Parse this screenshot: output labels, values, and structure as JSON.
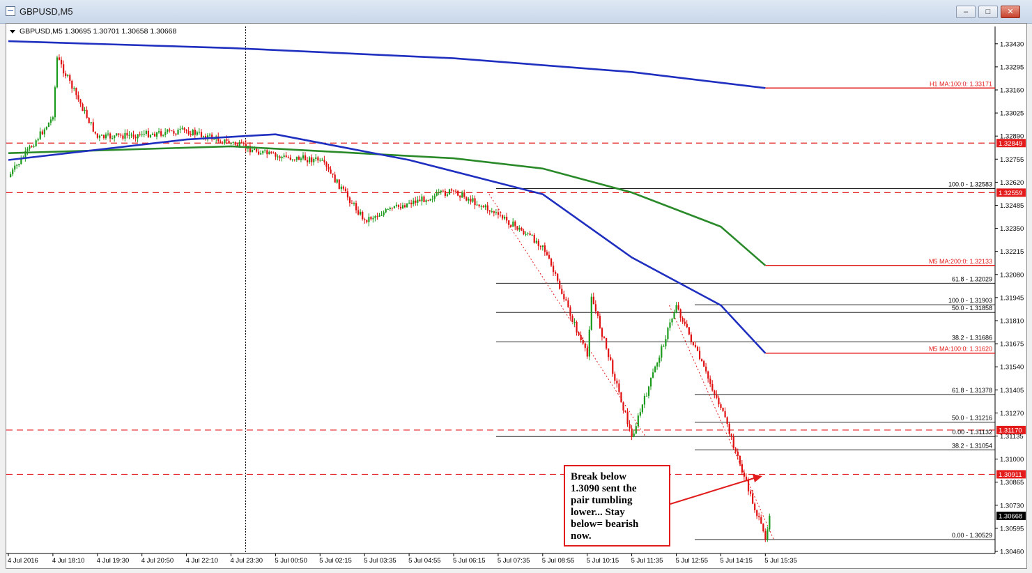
{
  "window": {
    "title": "GBPUSD,M5",
    "controls": [
      "minimize",
      "maximize",
      "close"
    ]
  },
  "chart_header": "GBPUSD,M5  1.30695 1.30701 1.30658 1.30668",
  "price_axis": {
    "ticks": [
      "1.33430",
      "1.33295",
      "1.33160",
      "1.33025",
      "1.32890",
      "1.32755",
      "1.32620",
      "1.32485",
      "1.32350",
      "1.32215",
      "1.32080",
      "1.31945",
      "1.31810",
      "1.31675",
      "1.31540",
      "1.31405",
      "1.31270",
      "1.31135",
      "1.31000",
      "1.30865",
      "1.30730",
      "1.30595",
      "1.30460"
    ]
  },
  "time_axis": {
    "ticks": [
      "4 Jul 2016",
      "4 Jul 18:10",
      "4 Jul 19:30",
      "4 Jul 20:50",
      "4 Jul 22:10",
      "4 Jul 23:30",
      "5 Jul 00:50",
      "5 Jul 02:15",
      "5 Jul 03:35",
      "5 Jul 04:55",
      "5 Jul 06:15",
      "5 Jul 07:35",
      "5 Jul 08:55",
      "5 Jul 10:15",
      "5 Jul 11:35",
      "5 Jul 12:55",
      "5 Jul 14:15",
      "5 Jul 15:35"
    ]
  },
  "colors": {
    "up": "#1b9b1b",
    "down": "#e01010",
    "ma_blue": "#1f2fbf",
    "ma_green": "#2a8a2a",
    "level_red": "#e31b1b"
  },
  "price_labels": [
    {
      "text": "1.32849",
      "color": "#e31b1b",
      "price": 1.32849
    },
    {
      "text": "1.32559",
      "color": "#e31b1b",
      "price": 1.32559
    },
    {
      "text": "1.31170",
      "color": "#e31b1b",
      "price": 1.3117
    },
    {
      "text": "1.30911",
      "color": "#e31b1b",
      "price": 1.30911
    },
    {
      "text": "1.30668",
      "color": "#000000",
      "price": 1.30668
    }
  ],
  "ma_labels": [
    {
      "text": "H1 MA:100:0: 1.33171",
      "price": 1.33171
    },
    {
      "text": "M5 MA:200:0: 1.32133",
      "price": 1.32133
    },
    {
      "text": "M5 MA:100:0: 1.31620",
      "price": 1.3162
    }
  ],
  "fib_labels": [
    {
      "text": "100.0 - 1.32583",
      "price": 1.32583
    },
    {
      "text": "61.8 - 1.32029",
      "price": 1.32029
    },
    {
      "text": "100.0 - 1.31903",
      "price": 1.31903
    },
    {
      "text": "50.0 - 1.31858",
      "price": 1.31858
    },
    {
      "text": "38.2 - 1.31686",
      "price": 1.31686
    },
    {
      "text": "61.8 - 1.31378",
      "price": 1.31378
    },
    {
      "text": "50.0 - 1.31216",
      "price": 1.31216
    },
    {
      "text": "0.00 - 1.31132",
      "price": 1.31132
    },
    {
      "text": "38.2 - 1.31054",
      "price": 1.31054
    },
    {
      "text": "0.00 - 1.30529",
      "price": 1.30529
    }
  ],
  "annotation": {
    "lines": [
      "Break below",
      "1.3090 sent the",
      "pair tumbling",
      "lower... Stay",
      "below= bearish",
      "now."
    ]
  },
  "chart_data": {
    "type": "candlestick",
    "title": "GBPUSD,M5",
    "timeframe": "M5",
    "ylim": [
      1.3046,
      1.3351
    ],
    "last_price": 1.30668,
    "path_points": [
      {
        "time": "4 Jul 2016",
        "price": 1.3265
      },
      {
        "time": "4 Jul 18:10",
        "price": 1.33
      },
      {
        "time": "4 Jul 18:10",
        "price": 1.3335
      },
      {
        "time": "4 Jul 19:30",
        "price": 1.3288
      },
      {
        "time": "4 Jul 20:50",
        "price": 1.329
      },
      {
        "time": "4 Jul 22:10",
        "price": 1.3292
      },
      {
        "time": "4 Jul 23:30",
        "price": 1.3285
      },
      {
        "time": "5 Jul 00:50",
        "price": 1.3277
      },
      {
        "time": "5 Jul 02:15",
        "price": 1.3275
      },
      {
        "time": "5 Jul 03:35",
        "price": 1.324
      },
      {
        "time": "5 Jul 04:55",
        "price": 1.325
      },
      {
        "time": "5 Jul 06:15",
        "price": 1.3257
      },
      {
        "time": "5 Jul 07:35",
        "price": 1.3243
      },
      {
        "time": "5 Jul 08:55",
        "price": 1.3225
      },
      {
        "time": "5 Jul 10:15",
        "price": 1.316
      },
      {
        "time": "5 Jul 10:15",
        "price": 1.3195
      },
      {
        "time": "5 Jul 11:35",
        "price": 1.3113
      },
      {
        "time": "5 Jul 12:55",
        "price": 1.319
      },
      {
        "time": "5 Jul 14:15",
        "price": 1.313
      },
      {
        "time": "5 Jul 15:35",
        "price": 1.3053
      },
      {
        "time": "5 Jul 15:35",
        "price": 1.30668
      }
    ],
    "moving_averages": [
      {
        "name": "H1 MA:100:0",
        "color": "#1f2fbf",
        "last": 1.33171,
        "points": [
          {
            "time": "4 Jul 2016",
            "price": 1.33445
          },
          {
            "time": "4 Jul 23:30",
            "price": 1.33405
          },
          {
            "time": "5 Jul 06:15",
            "price": 1.33345
          },
          {
            "time": "5 Jul 11:35",
            "price": 1.33265
          },
          {
            "time": "5 Jul 15:35",
            "price": 1.33171
          }
        ]
      },
      {
        "name": "M5 MA:200:0",
        "color": "#2a8a2a",
        "last": 1.32133,
        "points": [
          {
            "time": "4 Jul 2016",
            "price": 1.3279
          },
          {
            "time": "4 Jul 23:30",
            "price": 1.3283
          },
          {
            "time": "5 Jul 06:15",
            "price": 1.3276
          },
          {
            "time": "5 Jul 08:55",
            "price": 1.327
          },
          {
            "time": "5 Jul 11:35",
            "price": 1.3256
          },
          {
            "time": "5 Jul 14:15",
            "price": 1.3236
          },
          {
            "time": "5 Jul 15:35",
            "price": 1.32133
          }
        ]
      },
      {
        "name": "M5 MA:100:0",
        "color": "#1f2fbf",
        "last": 1.3162,
        "points": [
          {
            "time": "4 Jul 2016",
            "price": 1.3275
          },
          {
            "time": "4 Jul 22:10",
            "price": 1.3287
          },
          {
            "time": "5 Jul 00:50",
            "price": 1.329
          },
          {
            "time": "5 Jul 04:55",
            "price": 1.3275
          },
          {
            "time": "5 Jul 08:55",
            "price": 1.3255
          },
          {
            "time": "5 Jul 11:35",
            "price": 1.3218
          },
          {
            "time": "5 Jul 14:15",
            "price": 1.319
          },
          {
            "time": "5 Jul 15:35",
            "price": 1.3162
          }
        ]
      }
    ],
    "horizontal_levels": [
      1.32849,
      1.32559,
      1.3117,
      1.30911
    ],
    "fib_retracements": [
      {
        "levels": {
          "100.0": 1.32583,
          "61.8": 1.32029,
          "0.00": 1.31132
        }
      },
      {
        "levels": {
          "100.0": 1.31903,
          "50.0": 1.31858,
          "38.2": 1.31686
        }
      },
      {
        "levels": {
          "61.8": 1.31378,
          "50.0": 1.31216,
          "38.2": 1.31054,
          "0.00": 1.30529
        }
      }
    ],
    "grid": false
  }
}
